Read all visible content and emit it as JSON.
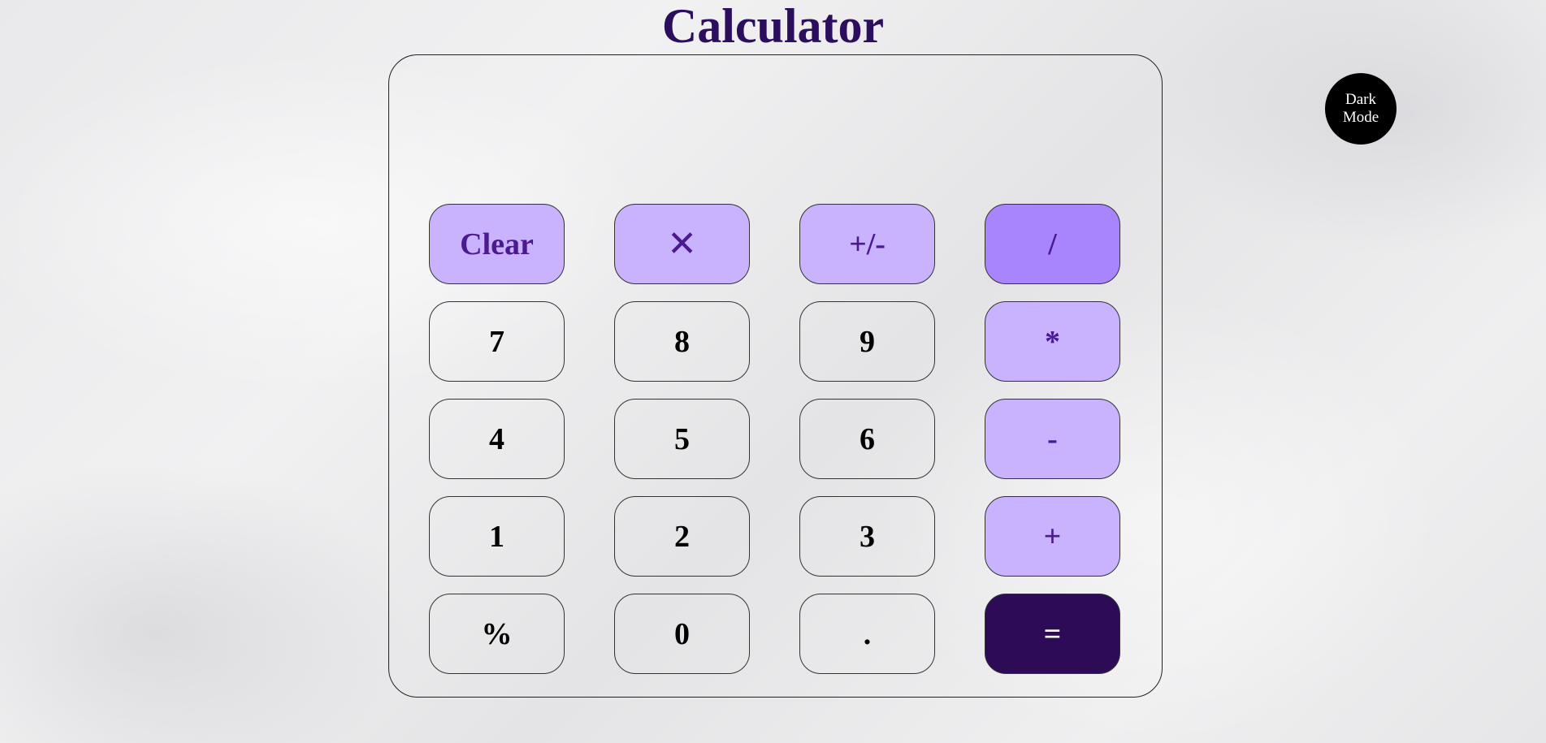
{
  "page": {
    "title": "Calculator"
  },
  "display": {
    "value": ""
  },
  "theme_toggle": {
    "label": "Dark Mode"
  },
  "keys": {
    "row1": [
      "Clear",
      "✕",
      "+/-",
      "/"
    ],
    "row2": [
      "7",
      "8",
      "9",
      "*"
    ],
    "row3": [
      "4",
      "5",
      "6",
      "-"
    ],
    "row4": [
      "1",
      "2",
      "3",
      "+"
    ],
    "row5": [
      "%",
      "0",
      ".",
      "="
    ]
  },
  "colors": {
    "title": "#2b0f5c",
    "function_key": "#c9b3ff",
    "divide_key": "#a885fd",
    "function_text": "#4b1a8f",
    "equals_key": "#2e0b57",
    "toggle_bg": "#000000"
  }
}
